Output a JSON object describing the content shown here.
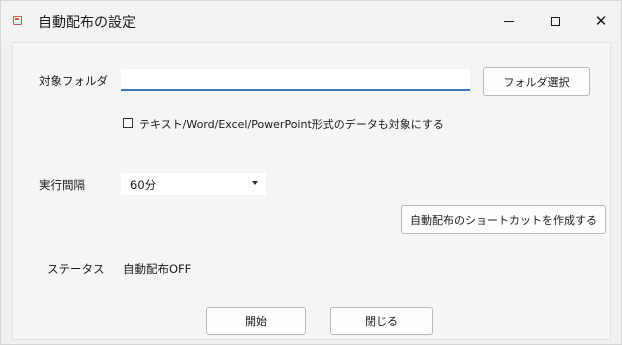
{
  "window": {
    "title": "自動配布の設定",
    "minimize_glyph": "–",
    "maximize_glyph": "□",
    "close_glyph": "✕"
  },
  "folder": {
    "label": "対象フォルダ",
    "input_value": "",
    "select_button": "フォルダ選択"
  },
  "options": {
    "include_office_label": "テキスト/Word/Excel/PowerPoint形式のデータも対象にする",
    "include_office_checked": false
  },
  "interval": {
    "label": "実行間隔",
    "selected": "60分"
  },
  "shortcut_button": "自動配布のショートカットを作成する",
  "status": {
    "label": "ステータス",
    "value": "自動配布OFF"
  },
  "actions": {
    "start": "開始",
    "close": "閉じる"
  }
}
